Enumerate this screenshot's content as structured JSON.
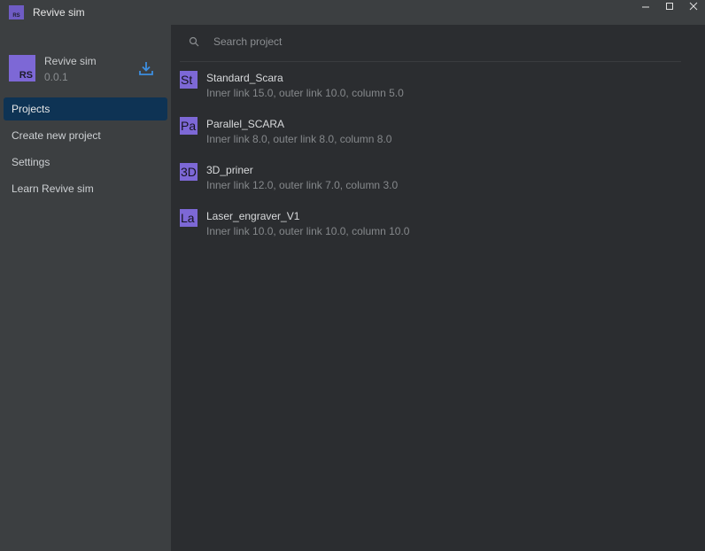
{
  "window": {
    "title": "Revive sim",
    "icon_text": "RS"
  },
  "sidebar": {
    "app_name": "Revive sim",
    "app_version": "0.0.1",
    "logo_text": "RS",
    "download_icon": "download-icon",
    "nav": [
      {
        "label": "Projects",
        "active": true
      },
      {
        "label": "Create new project",
        "active": false
      },
      {
        "label": "Settings",
        "active": false
      },
      {
        "label": "Learn Revive sim",
        "active": false
      }
    ]
  },
  "main": {
    "search": {
      "placeholder": "Search project",
      "value": ""
    },
    "projects": [
      {
        "badge": "St",
        "name": "Standard_Scara",
        "desc": "Inner link 15.0, outer link 10.0, column 5.0"
      },
      {
        "badge": "Pa",
        "name": "Parallel_SCARA",
        "desc": "Inner link 8.0, outer link 8.0, column 8.0"
      },
      {
        "badge": "3D",
        "name": "3D_priner",
        "desc": "Inner link 12.0, outer link 7.0, column 3.0"
      },
      {
        "badge": "La",
        "name": "Laser_engraver_V1",
        "desc": "Inner link 10.0, outer link 10.0, column 10.0"
      }
    ]
  },
  "colors": {
    "accent_badge": "#7d68d6",
    "active_nav": "#0e3354",
    "download_icon": "#3d8ee0"
  }
}
